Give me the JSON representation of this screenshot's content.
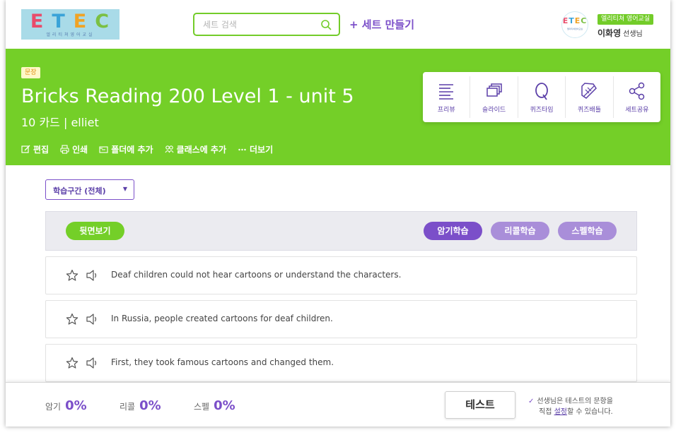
{
  "header": {
    "logo": {
      "letters": [
        "E",
        "T",
        "E",
        "C"
      ],
      "letter_colors": [
        "#e94c6b",
        "#3aa3d8",
        "#f0a325",
        "#7bc043"
      ],
      "subtitle": "엘리티쳐영어교실"
    },
    "search": {
      "placeholder": "세트 검색",
      "icon": "search-icon"
    },
    "make_set_label": "+ 세트 만들기",
    "user": {
      "org_badge": "엘리티쳐 영어교실",
      "name": "이화영",
      "name_suffix": "선생님"
    }
  },
  "banner": {
    "tag": "문장",
    "title": "Bricks Reading 200 Level 1 - unit 5",
    "meta": "10 카드  |  elliet",
    "actions": [
      {
        "label": "편집",
        "icon": "edit-icon"
      },
      {
        "label": "인쇄",
        "icon": "print-icon"
      },
      {
        "label": "폴더에 추가",
        "icon": "folder-add-icon"
      },
      {
        "label": "클래스에 추가",
        "icon": "class-add-icon"
      },
      {
        "label": "더보기",
        "icon": "more-icon"
      }
    ],
    "modes": [
      {
        "label": "프리뷰",
        "icon": "preview-icon"
      },
      {
        "label": "슬라이드",
        "icon": "slide-icon"
      },
      {
        "label": "퀴즈타임",
        "icon": "quiz-time-icon"
      },
      {
        "label": "퀴즈배틀",
        "icon": "quiz-battle-icon"
      },
      {
        "label": "세트공유",
        "icon": "share-icon"
      }
    ]
  },
  "study": {
    "section_select": "학습구간 (전체)",
    "flip_label": "뒷면보기",
    "memorize_label": "암기학습",
    "recall_label": "리콜학습",
    "spell_label": "스펠학습"
  },
  "cards": [
    "Deaf children could not hear cartoons or understand the characters.",
    "In Russia, people created cartoons for deaf children.",
    "First, they took famous cartoons and changed them."
  ],
  "bottom": {
    "memorize": {
      "label": "암기",
      "value": "0%"
    },
    "recall": {
      "label": "리콜",
      "value": "0%"
    },
    "spell": {
      "label": "스펠",
      "value": "0%"
    },
    "test_label": "테스트",
    "note_line1": "선생님은 테스트의 문항을",
    "note_line2_pre": "직접 ",
    "note_link": "설정",
    "note_line2_post": "할 수 있습니다."
  },
  "colors": {
    "green": "#74cf28",
    "purple": "#7b4fc9",
    "light_purple": "#a98ed9"
  }
}
